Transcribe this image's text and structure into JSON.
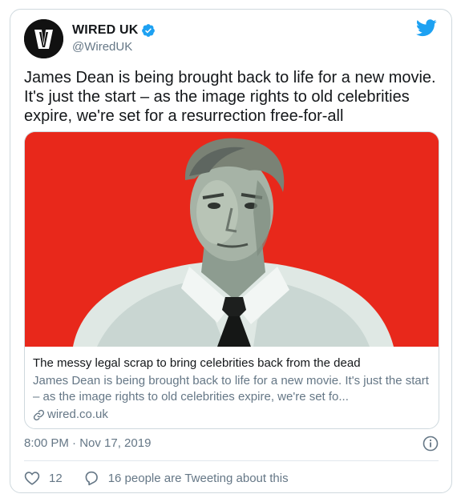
{
  "author": {
    "display_name": "WIRED UK",
    "handle": "@WiredUK",
    "verified": true,
    "avatar_icon": "wired-logo-icon"
  },
  "tweet": {
    "text": "James Dean is being brought back to life for a new movie. It's just the start – as the image rights to old celebrities expire, we're set for a resurrection free-for-all"
  },
  "link_card": {
    "title": "The messy legal scrap to bring celebrities back from the dead",
    "description": "James Dean is being brought back to life for a new movie. It's just the start – as the image rights to old celebrities expire, we're set fo...",
    "domain": "wired.co.uk"
  },
  "timestamp": "8:00 PM · Nov 17, 2019",
  "actions": {
    "likes": "12",
    "conversation": "16 people are Tweeting about this"
  },
  "colors": {
    "twitter_blue": "#1da1f2",
    "secondary_text": "#657786",
    "image_background": "#e8281b"
  }
}
